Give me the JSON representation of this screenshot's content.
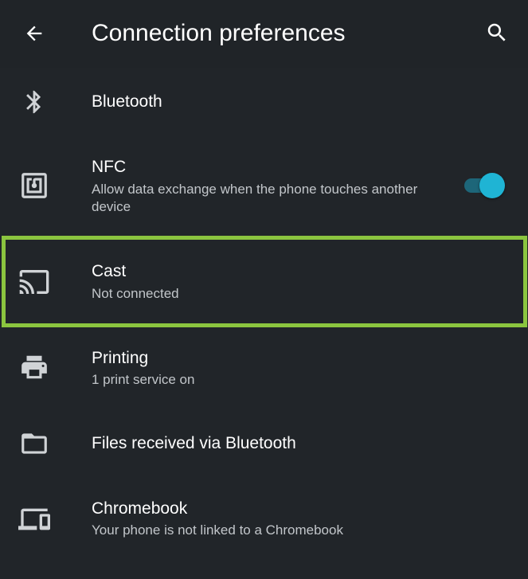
{
  "header": {
    "title": "Connection preferences",
    "back_icon": "arrow-back-icon",
    "search_icon": "search-icon"
  },
  "items": [
    {
      "id": "bluetooth",
      "title": "Bluetooth",
      "summary": "",
      "icon": "bluetooth-icon"
    },
    {
      "id": "nfc",
      "title": "NFC",
      "summary": "Allow data exchange when the phone touches another device",
      "icon": "nfc-icon",
      "toggle_on": true
    },
    {
      "id": "cast",
      "title": "Cast",
      "summary": "Not connected",
      "icon": "cast-icon",
      "highlighted": true
    },
    {
      "id": "printing",
      "title": "Printing",
      "summary": "1 print service on",
      "icon": "printer-icon"
    },
    {
      "id": "files",
      "title": "Files received via Bluetooth",
      "summary": "",
      "icon": "folder-icon"
    },
    {
      "id": "chromebook",
      "title": "Chromebook",
      "summary": "Your phone is not linked to a Chromebook",
      "icon": "devices-icon"
    }
  ],
  "colors": {
    "background": "#212529",
    "accent": "#1fb4d4",
    "highlight": "#8bc53f",
    "secondary_text": "#c2c6ca",
    "icon": "#d0d3d6"
  }
}
